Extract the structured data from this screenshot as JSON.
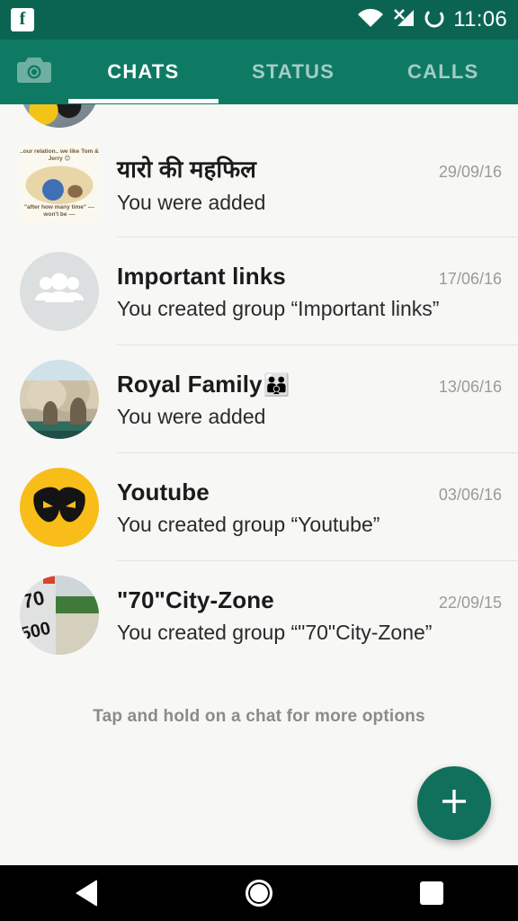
{
  "statusbar": {
    "app_icon": "facebook-icon",
    "fb_letter": "f",
    "wifi_icon": "wifi-icon",
    "signal_icon": "mobile-signal-no-sim-icon",
    "sync_icon": "sync-circle-icon",
    "time": "11:06"
  },
  "toolbar": {
    "camera_icon": "camera-icon",
    "tabs": [
      {
        "label": "CHATS",
        "active": true
      },
      {
        "label": "STATUS",
        "active": false
      },
      {
        "label": "CALLS",
        "active": false
      }
    ]
  },
  "chats": [
    {
      "title": "यारो की महफिल",
      "emoji": "",
      "subtitle": "You were added",
      "date": "29/09/16",
      "avatar": "tom-and-jerry-photo",
      "avatar_caption_top": "..our relation..\nwe like Tom & Jerry 😊",
      "avatar_caption_bottom": "\"after how many time\"\n–– won't be ––"
    },
    {
      "title": "Important links",
      "emoji": "",
      "subtitle": "You created group “Important links”",
      "date": "17/06/16",
      "avatar": "default-group-icon"
    },
    {
      "title": "Royal Family",
      "emoji": "👪",
      "subtitle": "You were added",
      "date": "13/06/16",
      "avatar": "fort-photo"
    },
    {
      "title": "Youtube",
      "emoji": "",
      "subtitle": "You created group “Youtube”",
      "date": "03/06/16",
      "avatar": "yellow-mask-logo"
    },
    {
      "title": "\"70\"City-Zone",
      "emoji": "",
      "subtitle": "You created group “\"70\"City-Zone”",
      "date": "22/09/15",
      "avatar": "roadside-milestone-photo",
      "avatar_text_1": "70",
      "avatar_text_2": "500"
    }
  ],
  "hint": {
    "text": "Tap and hold on a chat for more options"
  },
  "fab": {
    "icon": "plus-icon",
    "label": "+"
  },
  "navbar": {
    "back_icon": "back-triangle-icon",
    "home_icon": "home-circle-icon",
    "recents_icon": "recents-square-icon"
  },
  "colors": {
    "status_bar": "#0b6452",
    "toolbar": "#0f7a64",
    "accent_fab": "#10705c",
    "list_bg": "#f7f7f5",
    "title": "#1b1b1b",
    "date": "#9a9a98",
    "hint": "#8b8b89"
  }
}
